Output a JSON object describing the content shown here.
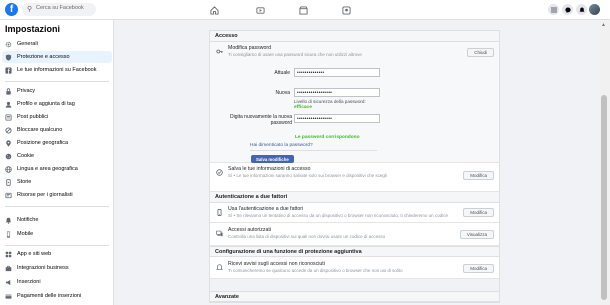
{
  "topbar": {
    "logo": "f",
    "search_placeholder": "Cerca su Facebook",
    "nav_icons": [
      "home-icon",
      "watch-icon",
      "marketplace-icon",
      "groups-icon"
    ],
    "right_icons": [
      "menu-icon",
      "messenger-icon",
      "notifications-icon",
      "account-avatar"
    ]
  },
  "sidebar": {
    "title": "Impostazioni",
    "items": [
      {
        "label": "Generali",
        "icon": "gear-icon"
      },
      {
        "label": "Protezione e accesso",
        "icon": "shield-icon"
      },
      {
        "label": "Le tue informazioni su Facebook",
        "icon": "facebook-icon"
      },
      {
        "label": "Privacy",
        "icon": "lock-icon"
      },
      {
        "label": "Profilo e aggiunta di tag",
        "icon": "tag-icon"
      },
      {
        "label": "Post pubblici",
        "icon": "post-icon"
      },
      {
        "label": "Bloccare qualcuno",
        "icon": "block-icon"
      },
      {
        "label": "Posizione geografica",
        "icon": "location-icon"
      },
      {
        "label": "Cookie",
        "icon": "cookie-icon"
      },
      {
        "label": "Lingua e area geografica",
        "icon": "language-icon"
      },
      {
        "label": "Storie",
        "icon": "stories-icon"
      },
      {
        "label": "Risorse per i giornalisti",
        "icon": "journalist-icon"
      },
      {
        "label": "Notifiche",
        "icon": "bell-icon"
      },
      {
        "label": "Mobile",
        "icon": "mobile-icon"
      },
      {
        "label": "App e siti web",
        "icon": "apps-icon"
      },
      {
        "label": "Integrazioni business",
        "icon": "business-icon"
      },
      {
        "label": "Inserzioni",
        "icon": "ads-icon"
      },
      {
        "label": "Pagamenti delle inserzioni",
        "icon": "payment-icon"
      }
    ]
  },
  "main": {
    "accesso": {
      "header": "Accesso",
      "change_password": {
        "title": "Modifica password",
        "subtitle": "Ti consigliamo di usare una password sicura che non utilizzi altrove",
        "close_label": "Chiudi",
        "current_label": "Attuale",
        "current_value": "••••••••••••••",
        "new_label": "Nuova",
        "new_value": "••••••••••••••••••",
        "strength_note": "Livello di sicurezza della password:",
        "strength_value": "efficace",
        "retype_label": "Digita nuovamente la nuova password",
        "retype_value": "••••••••••••••••••",
        "match_note": "Le password corrispondono",
        "forgot_link": "Hai dimenticato la password?",
        "save_label": "Salva modifiche"
      },
      "save_login": {
        "title": "Salva le tue informazioni di accesso",
        "subtitle": "Sì • Le tue informazioni saranno salvate solo sui browser e dispositivi che scegli",
        "button": "Modifica"
      }
    },
    "two_factor": {
      "header": "Autenticazione a due fattori",
      "use_2fa": {
        "title": "Usa l'autenticazione a due fattori",
        "subtitle": "Sì • Se rileviamo un tentativo di accesso da un dispositivo o browser non riconosciuto, ti chiederemo un codice",
        "button": "Modifica"
      },
      "authorized": {
        "title": "Accessi autorizzati",
        "subtitle": "Controlla una lista di dispositivi sui quali non dovrai usare un codice di accesso",
        "button": "Visualizza"
      }
    },
    "extra": {
      "header": "Configurazione di una funzione di protezione aggiuntiva",
      "alerts": {
        "title": "Ricevi avvisi sugli accessi non riconosciuti",
        "subtitle": "Ti comunicheremo se qualcuno accede da un dispositivo o browser che non usi di solito",
        "button": "Modifica"
      }
    },
    "advanced": {
      "header": "Avanzate"
    }
  }
}
